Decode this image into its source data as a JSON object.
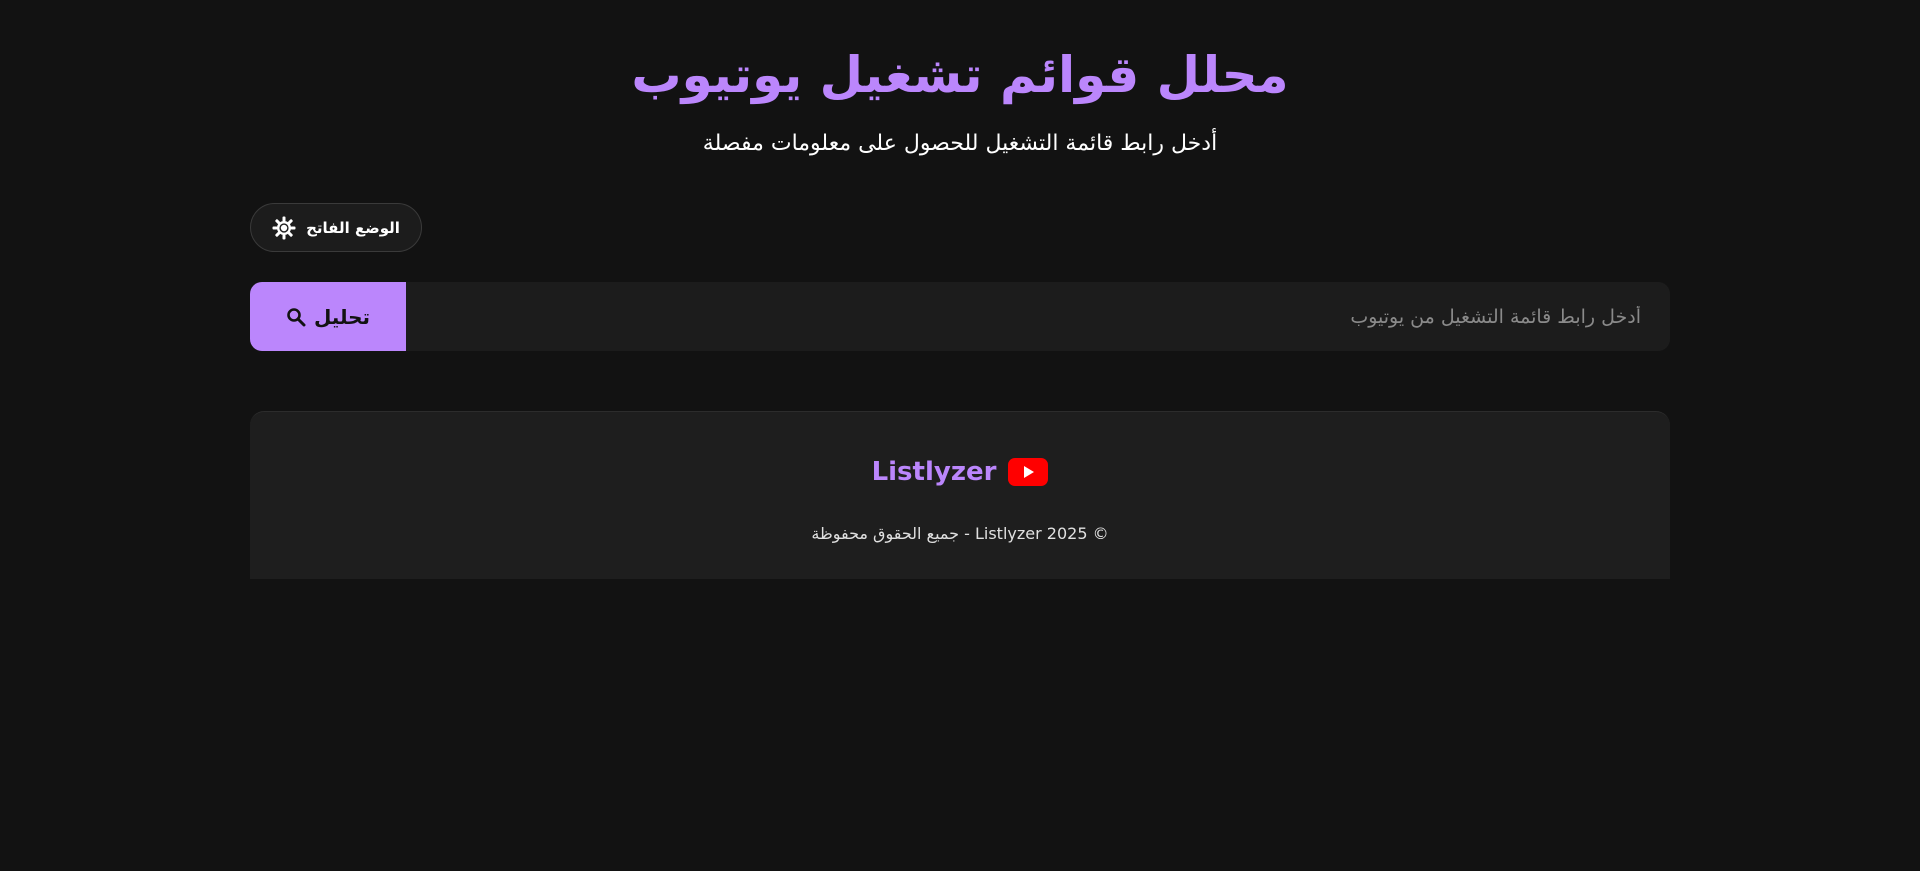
{
  "header": {
    "title": "محلل قوائم تشغيل يوتيوب",
    "subtitle": "أدخل رابط قائمة التشغيل للحصول على معلومات مفصلة"
  },
  "theme_toggle": {
    "label": "الوضع الفاتح",
    "icon": "sun-icon"
  },
  "search": {
    "placeholder": "أدخل رابط قائمة التشغيل من يوتيوب",
    "value": "",
    "button_label": "تحليل",
    "button_icon": "search-icon"
  },
  "footer": {
    "brand_name": "Listlyzer",
    "brand_icon": "youtube-icon",
    "copyright": "© 2025 Listlyzer - جميع الحقوق محفوظة"
  },
  "colors": {
    "background": "#121212",
    "accent": "#bb86fc",
    "surface": "#1c1c1c",
    "youtube_red": "#ff0000"
  }
}
